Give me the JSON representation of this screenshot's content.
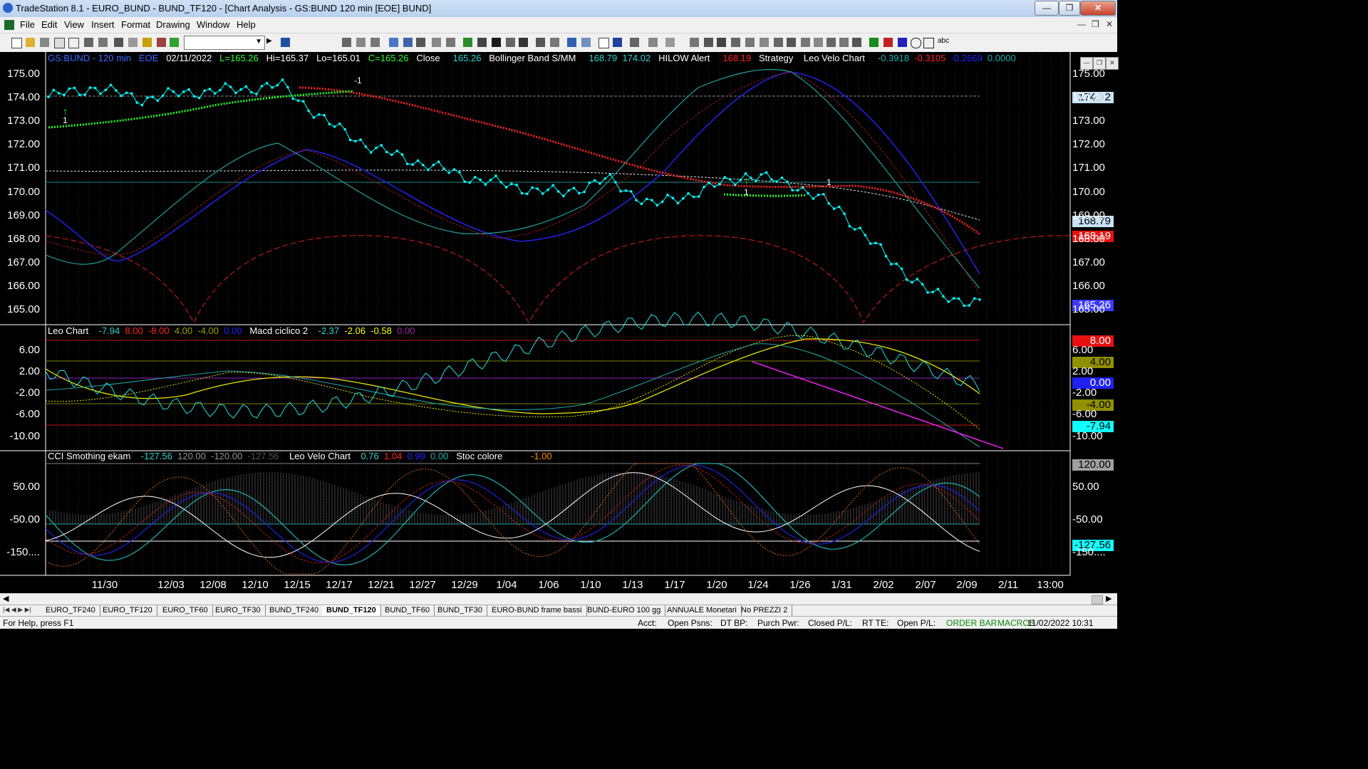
{
  "window": {
    "title": "TradeStation 8.1 - EURO_BUND - BUND_TF120 - [Chart Analysis - GS:BUND  120 min  [EOE] BUND]",
    "min_icon": "minimize-icon",
    "max_icon": "maximize-icon",
    "close_icon": "close-icon"
  },
  "menu": [
    "File",
    "Edit",
    "View",
    "Insert",
    "Format",
    "Drawing",
    "Window",
    "Help"
  ],
  "main_header": {
    "symbol": "GS:BUND - 120 min",
    "session": "EOE",
    "date": "02/11/2022",
    "last": "L=165.26",
    "high": "Hi=165.37",
    "low": "Lo=165.01",
    "close_c": "C=165.26",
    "close_label": "Close",
    "close_val": "165.26",
    "bb_label": "Bollinger Band S/MM",
    "bb_v1": "168.79",
    "bb_v2": "174.02",
    "hilow_label": "HILOW Alert",
    "hilow_val": "168.19",
    "strategy": "Strategy",
    "leovelo": "Leo Velo Chart",
    "lv1": "-0.3918",
    "lv2": "-0.3105",
    "lv3": "-0.2669",
    "lv4": "0.0000"
  },
  "pane2_header": {
    "leo": "Leo Chart",
    "v1": "-7.94",
    "v2": "8.00",
    "v3": "-8.00",
    "v4": "4.00",
    "v5": "-4.00",
    "v6": "0.00",
    "macd": "Macd ciclico 2",
    "m1": "-2.37",
    "m2": "-2.06",
    "m3": "-0.58",
    "m4": "0.00"
  },
  "pane3_header": {
    "cci": "CCI Smothing ekam",
    "c1": "-127.56",
    "c2": "120.00",
    "c3": "-120.00",
    "c4": "-127.56",
    "leovelo": "Leo Velo Chart",
    "l1": "0.76",
    "l2": "1.04",
    "l3": "0.99",
    "l4": "0.00",
    "stoc": "Stoc colore",
    "s1": "-1.00"
  },
  "markers": {
    "minus_one_a": "-1",
    "one_a": "1",
    "one_b": "1",
    "one_c": "1"
  },
  "price_axis": [
    "175.00",
    "174.00",
    "173.00",
    "172.00",
    "171.00",
    "170.00",
    "169.00",
    "168.00",
    "167.00",
    "166.00",
    "165.00"
  ],
  "price_tags": {
    "t1": "174.02",
    "t2": "168.79",
    "t3": "168.19",
    "t4": "165.26"
  },
  "pane2_axis": [
    "6.00",
    "2.00",
    "-2.00",
    "-6.00",
    "-10.00"
  ],
  "pane2_tags": {
    "t1": "8.00",
    "t2": "4.00",
    "t3": "0.00",
    "t4": "-4.00",
    "t5": "-7.94"
  },
  "pane3_axis": [
    "50.00",
    "-50.00",
    "-150...."
  ],
  "pane3_tags": {
    "t1": "120.00",
    "t2": "-127.56"
  },
  "x_axis": [
    "11/30",
    "12/03",
    "12/08",
    "12/10",
    "12/15",
    "12/17",
    "12/21",
    "12/27",
    "12/29",
    "1/04",
    "1/06",
    "1/10",
    "1/13",
    "1/17",
    "1/20",
    "1/24",
    "1/26",
    "1/31",
    "2/02",
    "2/07",
    "2/09",
    "2/11",
    "13:00"
  ],
  "tabs": [
    "EURO_TF240",
    "EURO_TF120",
    "EURO_TF60",
    "EURO_TF30",
    "BUND_TF240",
    "BUND_TF120",
    "BUND_TF60",
    "BUND_TF30",
    "EURO-BUND frame bassi",
    "BUND-EURO 100 gg",
    "ANNUALE Monetari",
    "No PREZZI 2"
  ],
  "status": {
    "help": "For Help, press F1",
    "acct": "Acct:",
    "open_psns": "Open Psns:",
    "dtbp": "DT BP:",
    "purch": "Purch Pwr:",
    "closed": "Closed P/L:",
    "rtte": "RT TE:",
    "openpl": "Open P/L:",
    "orderbar": "ORDER BAR",
    "macros": "MACROS",
    "datetime": "11/02/2022 10:31"
  },
  "colors": {
    "bg": "#000000",
    "price": "#00ffff",
    "green_stop": "#00ff00",
    "red_stop": "#ff0000",
    "blue_avg": "#2020e0",
    "teal": "#1fa0a0",
    "yellow": "#ffff00",
    "magenta": "#ff00ff",
    "white": "#ffffff"
  },
  "chart_data": {
    "type": "line",
    "title": "GS:BUND - 120 min",
    "x": [
      "11/30",
      "12/03",
      "12/08",
      "12/10",
      "12/15",
      "12/17",
      "12/21",
      "12/27",
      "12/29",
      "1/04",
      "1/06",
      "1/10",
      "1/13",
      "1/17",
      "1/20",
      "1/24",
      "1/26",
      "1/31",
      "2/02",
      "2/07",
      "2/09"
    ],
    "series": [
      {
        "name": "Close",
        "values": [
          174.0,
          174.4,
          173.9,
          174.2,
          174.3,
          174.5,
          172.9,
          171.8,
          171.2,
          170.6,
          170.2,
          169.9,
          170.5,
          169.4,
          170.0,
          170.7,
          170.3,
          169.2,
          167.2,
          165.6,
          165.26
        ]
      }
    ],
    "ylim": [
      164.8,
      175.3
    ],
    "grid": false
  }
}
